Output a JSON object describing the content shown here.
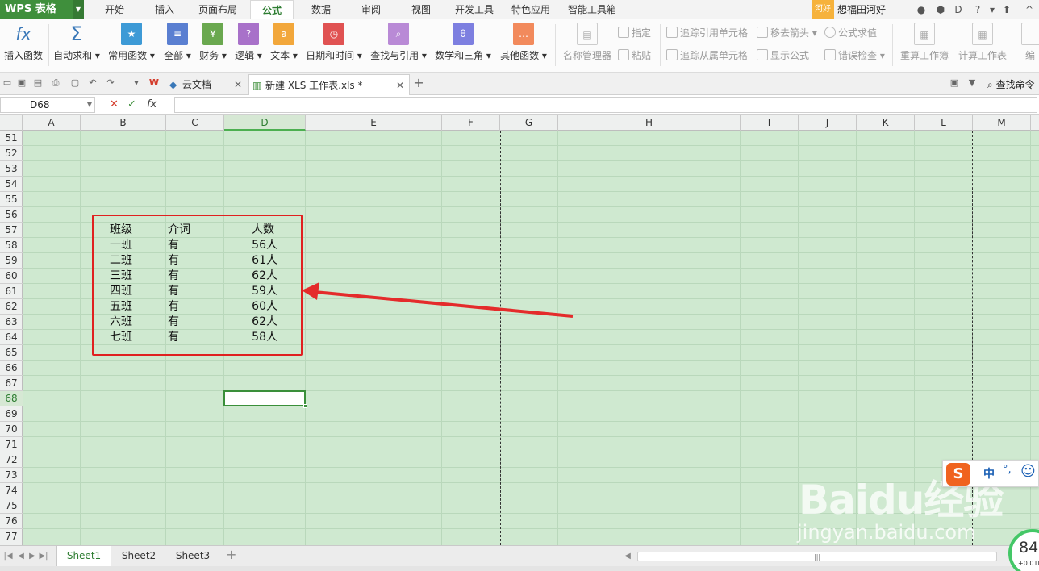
{
  "app": {
    "name": "WPS 表格",
    "menu_tabs": [
      "开始",
      "插入",
      "页面布局",
      "公式",
      "数据",
      "审阅",
      "视图",
      "开发工具",
      "特色应用",
      "智能工具箱"
    ],
    "active_tab": "公式",
    "user_badge": "河好",
    "user_name": "想福田河好"
  },
  "ribbon": {
    "insert_function": "插入函数",
    "buttons": [
      "自动求和",
      "常用函数",
      "全部",
      "财务",
      "逻辑",
      "文本",
      "日期和时间",
      "查找与引用",
      "数学和三角",
      "其他函数"
    ],
    "name_manager": "名称管理器",
    "assign": "指定",
    "paste": "粘贴",
    "trace_precedents": "追踪引用单元格",
    "trace_dependents": "追踪从属单元格",
    "remove_arrows": "移去箭头",
    "show_formulas": "显示公式",
    "evaluate_formula": "公式求值",
    "error_check": "错误检查",
    "recalc_workbook": "重算工作簿",
    "calc_sheet": "计算工作表",
    "edit_cut": "编"
  },
  "docbar": {
    "tabs": [
      {
        "label": "云文档"
      },
      {
        "label": "新建 XLS 工作表.xls *"
      }
    ],
    "find_command": "查找命令"
  },
  "formula_bar": {
    "name_box": "D68",
    "formula": ""
  },
  "grid": {
    "columns": [
      "A",
      "B",
      "C",
      "D",
      "E",
      "F",
      "G",
      "H",
      "I",
      "J",
      "K",
      "L",
      "M"
    ],
    "selected_column": "D",
    "rows": [
      "51",
      "52",
      "53",
      "54",
      "55",
      "56",
      "57",
      "58",
      "59",
      "60",
      "61",
      "62",
      "63",
      "64",
      "65",
      "66",
      "67",
      "68",
      "69",
      "70",
      "71",
      "72",
      "73",
      "74",
      "75",
      "76",
      "77"
    ],
    "selected_row": "68",
    "table": {
      "header": [
        "班级",
        "介词",
        "人数"
      ],
      "rows": [
        [
          "一班",
          "有",
          "56人"
        ],
        [
          "二班",
          "有",
          "61人"
        ],
        [
          "三班",
          "有",
          "62人"
        ],
        [
          "四班",
          "有",
          "59人"
        ],
        [
          "五班",
          "有",
          "60人"
        ],
        [
          "六班",
          "有",
          "62人"
        ],
        [
          "七班",
          "有",
          "58人"
        ]
      ]
    }
  },
  "sheets": {
    "tabs": [
      "Sheet1",
      "Sheet2",
      "Sheet3"
    ],
    "active": "Sheet1"
  },
  "ime": {
    "mode": "中",
    "punct": "°,"
  },
  "watermark": {
    "logo": "Baidu经验",
    "url": "jingyan.baidu.com"
  },
  "speed": {
    "value": "84",
    "unit": "+0.01K"
  },
  "colors": {
    "sheet_bg": "#cfe9d0",
    "accent": "#3f8f3c",
    "highlight_red": "#e02020"
  }
}
